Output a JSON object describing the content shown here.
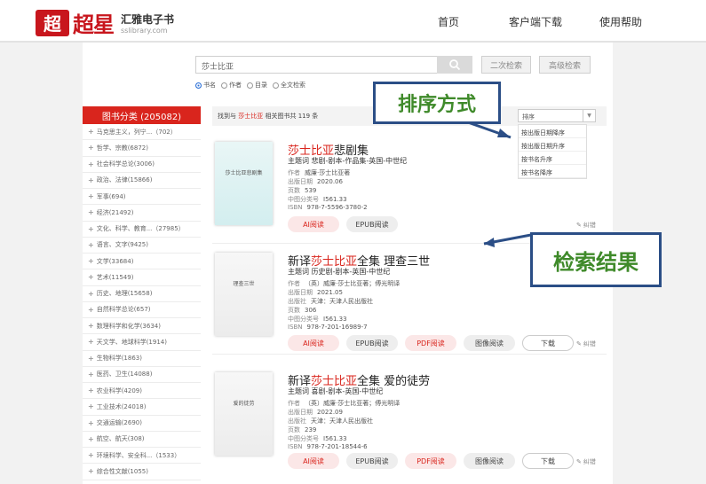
{
  "header": {
    "logo_mark": "超",
    "logo_name": "超星",
    "brand_title": "汇雅电子书",
    "brand_url": "sslibrary.com",
    "nav": [
      "首页",
      "客户端下载",
      "使用帮助"
    ]
  },
  "search": {
    "query": "莎士比亚",
    "secondary_label": "二次检索",
    "advanced_label": "高级检索",
    "options": [
      "书名",
      "作者",
      "目录",
      "全文检索"
    ],
    "selected_option": "书名"
  },
  "sidebar": {
    "title": "图书分类 (205082)",
    "items": [
      "马克思主义，列宁...（702）",
      "哲学、宗教(6872)",
      "社会科学总论(3006)",
      "政治、法律(15866)",
      "军事(694)",
      "经济(21492)",
      "文化、科学、教育...（27985）",
      "语言、文字(9425)",
      "文学(33684)",
      "艺术(11549)",
      "历史、地理(15658)",
      "自然科学总论(657)",
      "数理科学和化学(3634)",
      "天文学、地球科学(1914)",
      "生物科学(1863)",
      "医药、卫生(14088)",
      "农业科学(4209)",
      "工业技术(24018)",
      "交通运输(2690)",
      "航空、航天(308)",
      "环境科学、安全科...（1533）",
      "综合性文献(1055)"
    ]
  },
  "results": {
    "summary_prefix": "找到与",
    "summary_keyword": "莎士比亚",
    "summary_suffix": "相关图书共 119 条",
    "sort_label": "排序",
    "sort_options": [
      "按出版日期降序",
      "按出版日期升序",
      "按书名升序",
      "按书名降序"
    ],
    "books": [
      {
        "title_hl": "莎士比亚",
        "title_rest": "悲剧集",
        "subject": "主题词 悲剧-剧本-作品集-英国-中世纪",
        "meta": [
          {
            "k": "作者",
            "v": "威廉·莎士比亚著"
          },
          {
            "k": "出版日期",
            "v": "2020.06"
          },
          {
            "k": "页数",
            "v": "539"
          },
          {
            "k": "中图分类号",
            "v": "I561.33"
          },
          {
            "k": "ISBN",
            "v": "978-7-5596-3780-2"
          }
        ],
        "cover_title": "莎士比亚悲剧集",
        "buttons": [
          "AI阅读",
          "EPUB阅读"
        ],
        "error_label": "纠错"
      },
      {
        "title_pre": "新译",
        "title_hl": "莎士比亚",
        "title_rest": "全集 理查三世",
        "subject": "主题词 历史剧-剧本-英国-中世纪",
        "meta": [
          {
            "k": "作者",
            "v": "（英）威廉·莎士比亚著；傅光明译"
          },
          {
            "k": "出版日期",
            "v": "2021.05"
          },
          {
            "k": "出版社",
            "v": "天津：天津人民出版社"
          },
          {
            "k": "页数",
            "v": "306"
          },
          {
            "k": "中图分类号",
            "v": "I561.33"
          },
          {
            "k": "ISBN",
            "v": "978-7-201-16989-7"
          }
        ],
        "cover_title": "理查三世",
        "buttons": [
          "AI阅读",
          "EPUB阅读",
          "PDF阅读",
          "图像阅读",
          "下载"
        ],
        "error_label": "纠错"
      },
      {
        "title_pre": "新译",
        "title_hl": "莎士比亚",
        "title_rest": "全集 爱的徒劳",
        "subject": "主题词 喜剧-剧本-英国-中世纪",
        "meta": [
          {
            "k": "作者",
            "v": "（英）威廉·莎士比亚著；傅光明译"
          },
          {
            "k": "出版日期",
            "v": "2022.09"
          },
          {
            "k": "出版社",
            "v": "天津：天津人民出版社"
          },
          {
            "k": "页数",
            "v": "239"
          },
          {
            "k": "中图分类号",
            "v": "I561.33"
          },
          {
            "k": "ISBN",
            "v": "978-7-201-18544-6"
          }
        ],
        "cover_title": "爱的徒劳",
        "buttons": [
          "AI阅读",
          "EPUB阅读",
          "PDF阅读",
          "图像阅读",
          "下载"
        ],
        "error_label": "纠错"
      }
    ]
  },
  "annotations": {
    "sort_callout": "排序方式",
    "results_callout": "检索结果",
    "arrow_color": "#2b4e86",
    "text_color": "#3f8a2a"
  }
}
